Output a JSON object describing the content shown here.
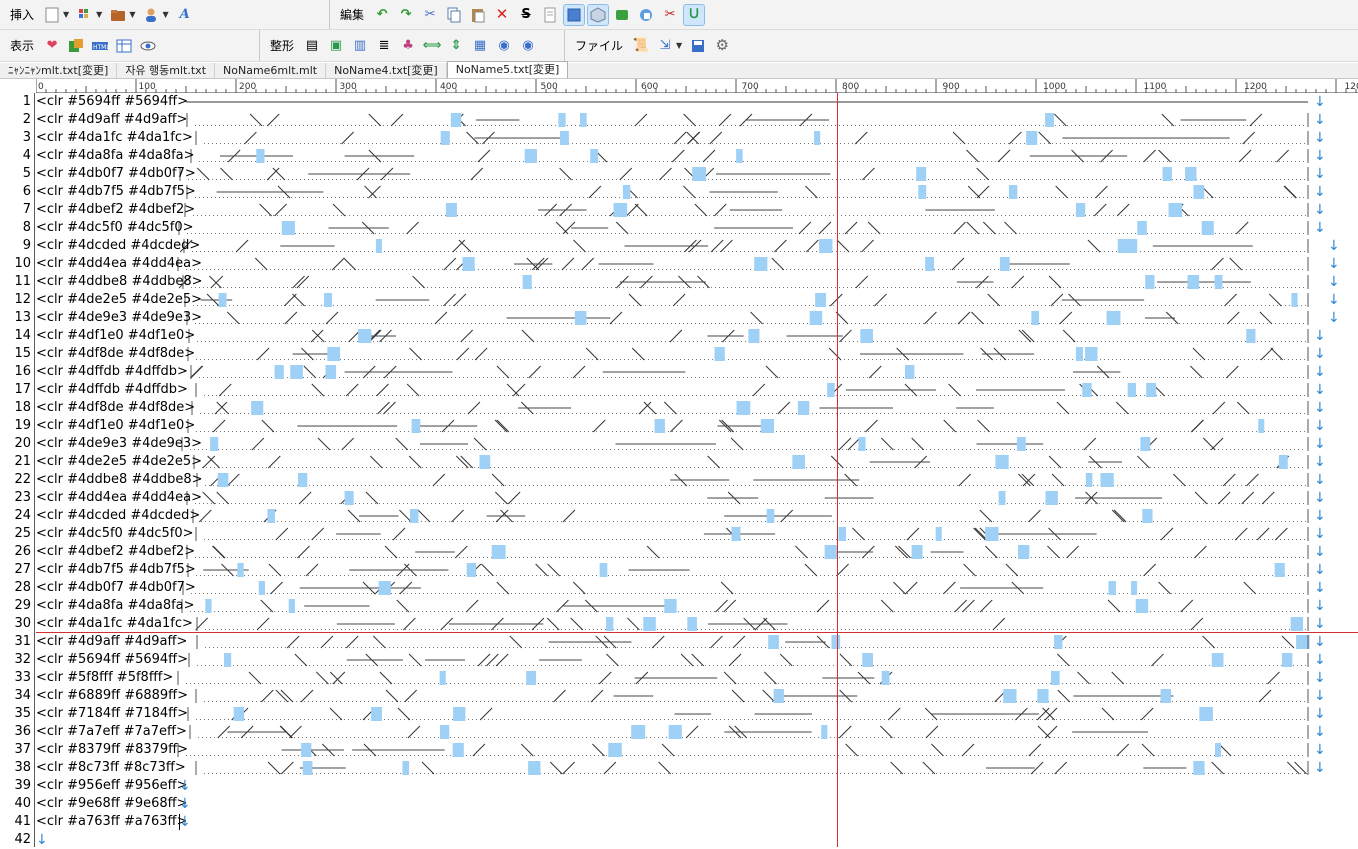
{
  "toolbar1": {
    "groups": [
      {
        "label": "挿入",
        "icons": [
          "new-doc-icon",
          "grid-icon",
          "folder-icon",
          "user-icon",
          "font-a-icon"
        ]
      },
      {
        "label": "編集",
        "icons": [
          "undo-icon",
          "redo-icon",
          "cut-icon",
          "copy-icon",
          "paste-icon",
          "delete-icon",
          "strike-icon",
          "page-icon",
          "select-box-icon",
          "cube-icon",
          "green-box-icon",
          "refresh-icon",
          "scissors-icon",
          "frame-u-icon"
        ]
      }
    ]
  },
  "toolbar2": {
    "groups": [
      {
        "label": "表示",
        "icons": [
          "heart-icon",
          "palette-icon",
          "html-icon",
          "table-icon",
          "eye-icon"
        ]
      },
      {
        "label": "整形",
        "icons": [
          "align-icon",
          "play-icon",
          "left-align-icon",
          "list-icon",
          "format-icon",
          "horizontal-arrows-icon",
          "vertical-arrows-icon",
          "stack-icon",
          "prev-icon",
          "next-icon"
        ]
      },
      {
        "label": "ファイル",
        "icons": [
          "scroll-icon",
          "export-icon",
          "save-icon",
          "settings-icon"
        ]
      }
    ]
  },
  "tabs": [
    {
      "label": "ﾆｬﾝﾆｬﾝmlt.txt[変更]",
      "active": false
    },
    {
      "label": "자유 행동mlt.txt",
      "active": false
    },
    {
      "label": "NoName6mlt.mlt",
      "active": false
    },
    {
      "label": "NoName4.txt[変更]",
      "active": false
    },
    {
      "label": "NoName5.txt[変更]",
      "active": true
    }
  ],
  "ruler_labels": [
    "0",
    "100",
    "200",
    "300",
    "400",
    "500",
    "600",
    "700",
    "800",
    "900",
    "1000",
    "1100",
    "1200",
    "120"
  ],
  "lines": [
    {
      "n": "1",
      "text": "<clr #5694ff #5694ff>"
    },
    {
      "n": "2",
      "text": "<clr #4d9aff #4d9aff>"
    },
    {
      "n": "3",
      "text": "<clr #4da1fc #4da1fc>"
    },
    {
      "n": "4",
      "text": "<clr #4da8fa #4da8fa>"
    },
    {
      "n": "5",
      "text": "<clr #4db0f7 #4db0f7>"
    },
    {
      "n": "6",
      "text": "<clr #4db7f5 #4db7f5>"
    },
    {
      "n": "7",
      "text": "<clr #4dbef2 #4dbef2>"
    },
    {
      "n": "8",
      "text": "<clr #4dc5f0 #4dc5f0>"
    },
    {
      "n": "9",
      "text": "<clr #4dcded #4dcded>"
    },
    {
      "n": "10",
      "text": "<clr #4dd4ea #4dd4ea>"
    },
    {
      "n": "11",
      "text": "<clr #4ddbe8 #4ddbe8>"
    },
    {
      "n": "12",
      "text": "<clr #4de2e5 #4de2e5>"
    },
    {
      "n": "13",
      "text": "<clr #4de9e3 #4de9e3>"
    },
    {
      "n": "14",
      "text": "<clr #4df1e0 #4df1e0>"
    },
    {
      "n": "15",
      "text": "<clr #4df8de #4df8de>"
    },
    {
      "n": "16",
      "text": "<clr #4dffdb #4dffdb>"
    },
    {
      "n": "17",
      "text": "<clr #4dffdb #4dffdb>"
    },
    {
      "n": "18",
      "text": "<clr #4df8de #4df8de>"
    },
    {
      "n": "19",
      "text": "<clr #4df1e0 #4df1e0>"
    },
    {
      "n": "20",
      "text": "<clr #4de9e3 #4de9e3>"
    },
    {
      "n": "21",
      "text": "<clr #4de2e5 #4de2e5>"
    },
    {
      "n": "22",
      "text": "<clr #4ddbe8 #4ddbe8>"
    },
    {
      "n": "23",
      "text": "<clr #4dd4ea #4dd4ea>"
    },
    {
      "n": "24",
      "text": "<clr #4dcded #4dcded>"
    },
    {
      "n": "25",
      "text": "<clr #4dc5f0 #4dc5f0>"
    },
    {
      "n": "26",
      "text": "<clr #4dbef2 #4dbef2>"
    },
    {
      "n": "27",
      "text": "<clr #4db7f5 #4db7f5>"
    },
    {
      "n": "28",
      "text": "<clr #4db0f7 #4db0f7>"
    },
    {
      "n": "29",
      "text": "<clr #4da8fa #4da8fa>"
    },
    {
      "n": "30",
      "text": "<clr #4da1fc #4da1fc>"
    },
    {
      "n": "31",
      "text": "<clr #4d9aff #4d9aff>"
    },
    {
      "n": "32",
      "text": "<clr #5694ff #5694ff>"
    },
    {
      "n": "33",
      "text": "<clr #5f8fff #5f8fff>"
    },
    {
      "n": "34",
      "text": "<clr #6889ff #6889ff>"
    },
    {
      "n": "35",
      "text": "<clr #7184ff #7184ff>"
    },
    {
      "n": "36",
      "text": "<clr #7a7eff #7a7eff>"
    },
    {
      "n": "37",
      "text": "<clr #8379ff #8379ff>"
    },
    {
      "n": "38",
      "text": "<clr #8c73ff #8c73ff>"
    },
    {
      "n": "39",
      "text": "<clr #956eff #956eff>"
    },
    {
      "n": "40",
      "text": "<clr #9e68ff #9e68ff>"
    },
    {
      "n": "41",
      "text": "<clr #a763ff #a763ff>"
    },
    {
      "n": "42",
      "text": ""
    }
  ],
  "colors": {
    "accent": "#2f86d4",
    "cursor_line": "#d23030",
    "highlight": "#9fd0f5"
  }
}
